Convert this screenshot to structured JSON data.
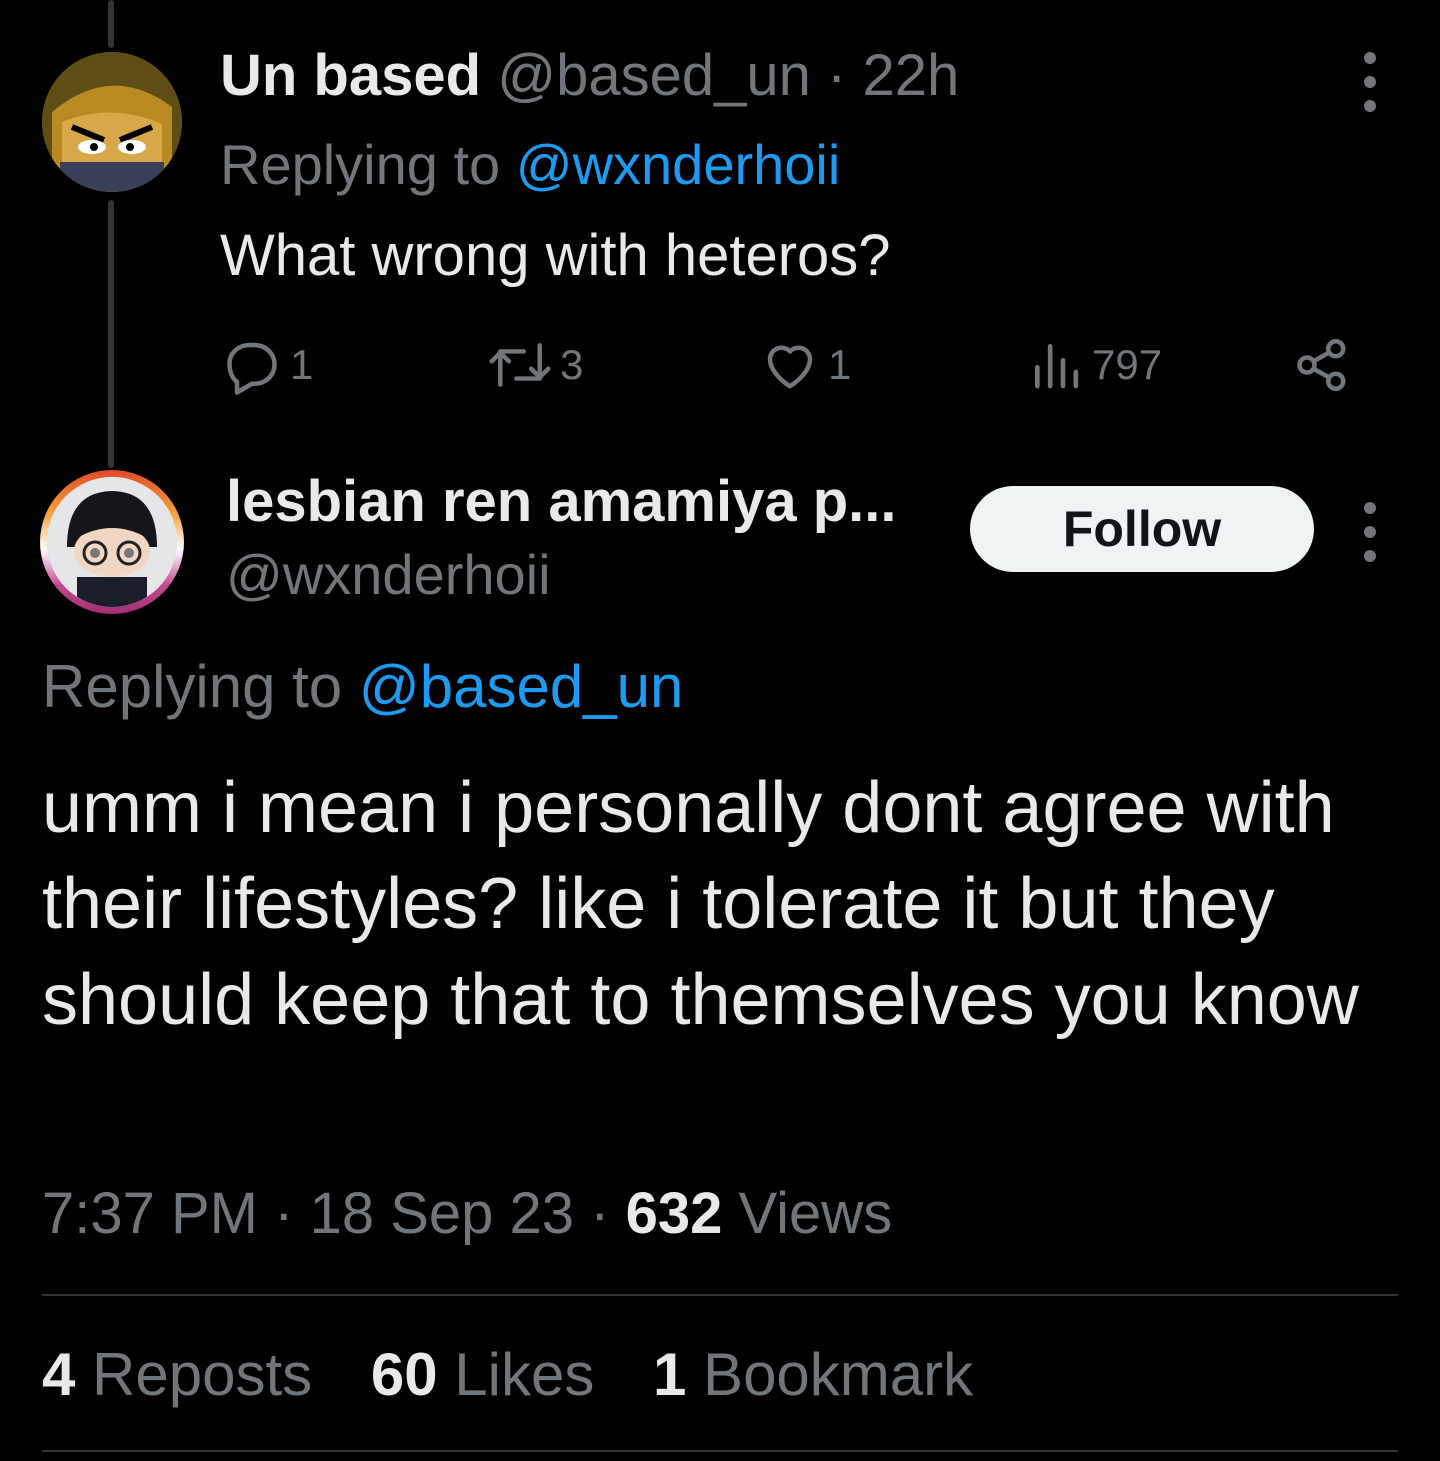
{
  "parent_tweet": {
    "display_name": "Un based",
    "handle": "@based_un",
    "separator": "·",
    "time": "22h",
    "replying_prefix": "Replying to ",
    "replying_to": "@wxnderhoii",
    "text": "What wrong with heteros?",
    "actions": {
      "reply_count": "1",
      "repost_count": "3",
      "like_count": "1",
      "views_count": "797"
    }
  },
  "main_tweet": {
    "display_name": "lesbian ren amamiya p...",
    "handle": "@wxnderhoii",
    "follow_label": "Follow",
    "replying_prefix": "Replying to ",
    "replying_to": "@based_un",
    "text": "umm i mean i personally dont agree with their lifestyles? like i tolerate it but they should keep that to themselves you know",
    "time": "7:37 PM",
    "date": "18 Sep 23",
    "views_count": "632",
    "views_label": "Views",
    "separator": "·"
  },
  "stats": {
    "reposts_count": "4",
    "reposts_label": "Reposts",
    "likes_count": "60",
    "likes_label": "Likes",
    "bookmarks_count": "1",
    "bookmarks_label": "Bookmark"
  },
  "colors": {
    "background": "#000000",
    "text_primary": "#e7e9ea",
    "text_secondary": "#71767b",
    "link": "#1d9bf0",
    "follow_bg": "#eff3f4"
  }
}
